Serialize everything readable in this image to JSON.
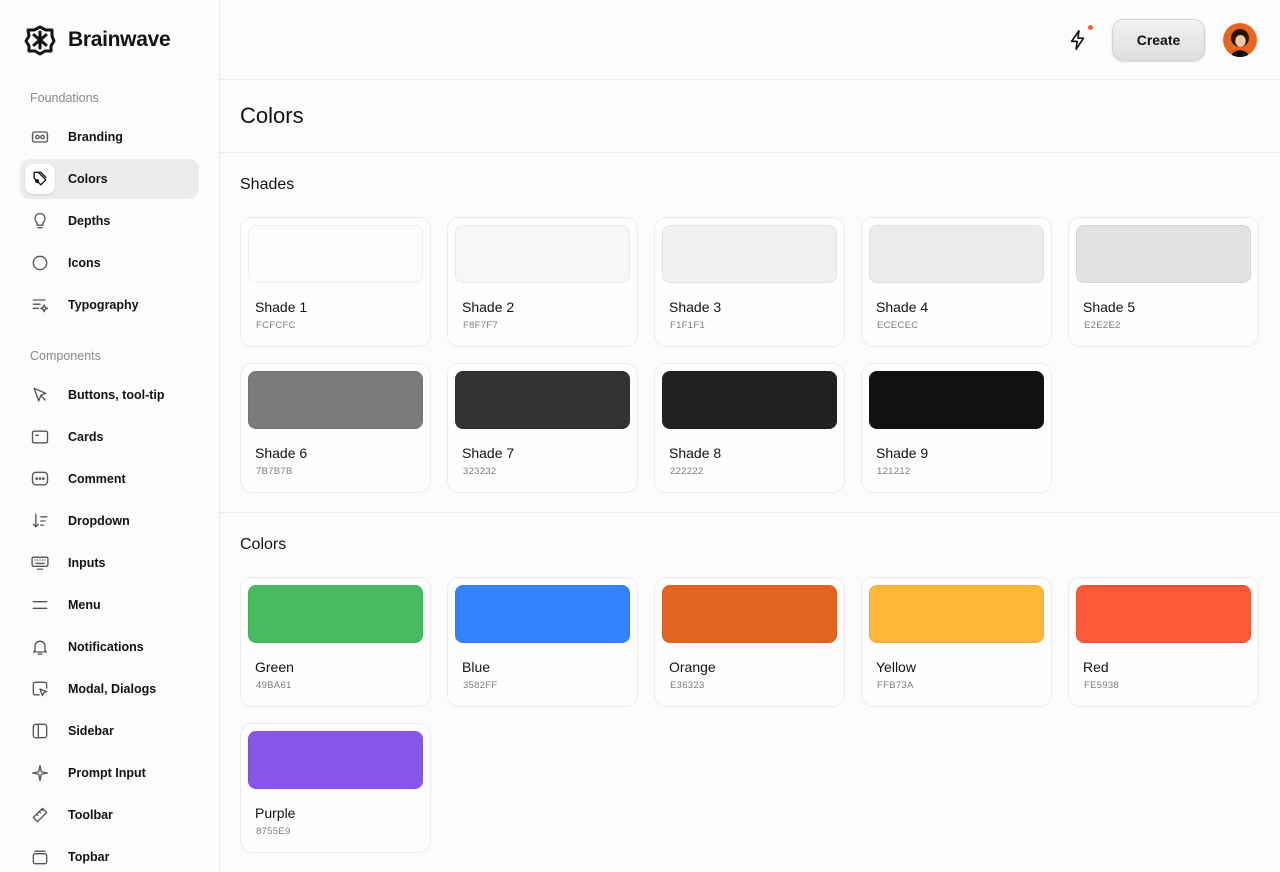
{
  "app": {
    "name": "Brainwave"
  },
  "sidebar": {
    "foundations_label": "Foundations",
    "foundations": [
      {
        "label": "Branding",
        "icon": "branding-icon",
        "active": false
      },
      {
        "label": "Colors",
        "icon": "palette-icon",
        "active": true
      },
      {
        "label": "Depths",
        "icon": "lightbulb-icon",
        "active": false
      },
      {
        "label": "Icons",
        "icon": "circle-icon",
        "active": false
      },
      {
        "label": "Typography",
        "icon": "typography-icon",
        "active": false
      }
    ],
    "components_label": "Components",
    "components": [
      {
        "label": "Buttons, tool-tip",
        "icon": "cursor-icon"
      },
      {
        "label": "Cards",
        "icon": "card-icon"
      },
      {
        "label": "Comment",
        "icon": "comment-icon"
      },
      {
        "label": "Dropdown",
        "icon": "sort-icon"
      },
      {
        "label": "Inputs",
        "icon": "keyboard-icon"
      },
      {
        "label": "Menu",
        "icon": "menu-icon"
      },
      {
        "label": "Notifications",
        "icon": "bell-icon"
      },
      {
        "label": "Modal, Dialogs",
        "icon": "modal-icon"
      },
      {
        "label": "Sidebar",
        "icon": "sidebar-icon"
      },
      {
        "label": "Prompt Input",
        "icon": "sparkle-icon"
      },
      {
        "label": "Toolbar",
        "icon": "ruler-icon"
      },
      {
        "label": "Topbar",
        "icon": "topbar-icon"
      }
    ]
  },
  "topbar": {
    "notification_dot_color": "#FE5938",
    "create_label": "Create"
  },
  "main": {
    "title": "Colors",
    "shades_title": "Shades",
    "shades": [
      {
        "name": "Shade 1",
        "hex": "FCFCFC",
        "color": "#FCFCFC"
      },
      {
        "name": "Shade 2",
        "hex": "F8F7F7",
        "color": "#F8F7F7"
      },
      {
        "name": "Shade 3",
        "hex": "F1F1F1",
        "color": "#F1F1F1"
      },
      {
        "name": "Shade 4",
        "hex": "ECECEC",
        "color": "#ECECEC"
      },
      {
        "name": "Shade 5",
        "hex": "E2E2E2",
        "color": "#E2E2E2"
      },
      {
        "name": "Shade 6",
        "hex": "7B7B7B",
        "color": "#7B7B7B"
      },
      {
        "name": "Shade 7",
        "hex": "323232",
        "color": "#323232"
      },
      {
        "name": "Shade 8",
        "hex": "222222",
        "color": "#222222"
      },
      {
        "name": "Shade 9",
        "hex": "121212",
        "color": "#121212"
      }
    ],
    "colors_title": "Colors",
    "colors": [
      {
        "name": "Green",
        "hex": "49BA61",
        "color": "#49BA61"
      },
      {
        "name": "Blue",
        "hex": "3582FF",
        "color": "#3582FF"
      },
      {
        "name": "Orange",
        "hex": "E36323",
        "color": "#E36323"
      },
      {
        "name": "Yellow",
        "hex": "FFB73A",
        "color": "#FFB73A"
      },
      {
        "name": "Red",
        "hex": "FE5938",
        "color": "#FE5938"
      },
      {
        "name": "Purple",
        "hex": "8755E9",
        "color": "#8755E9"
      }
    ]
  }
}
